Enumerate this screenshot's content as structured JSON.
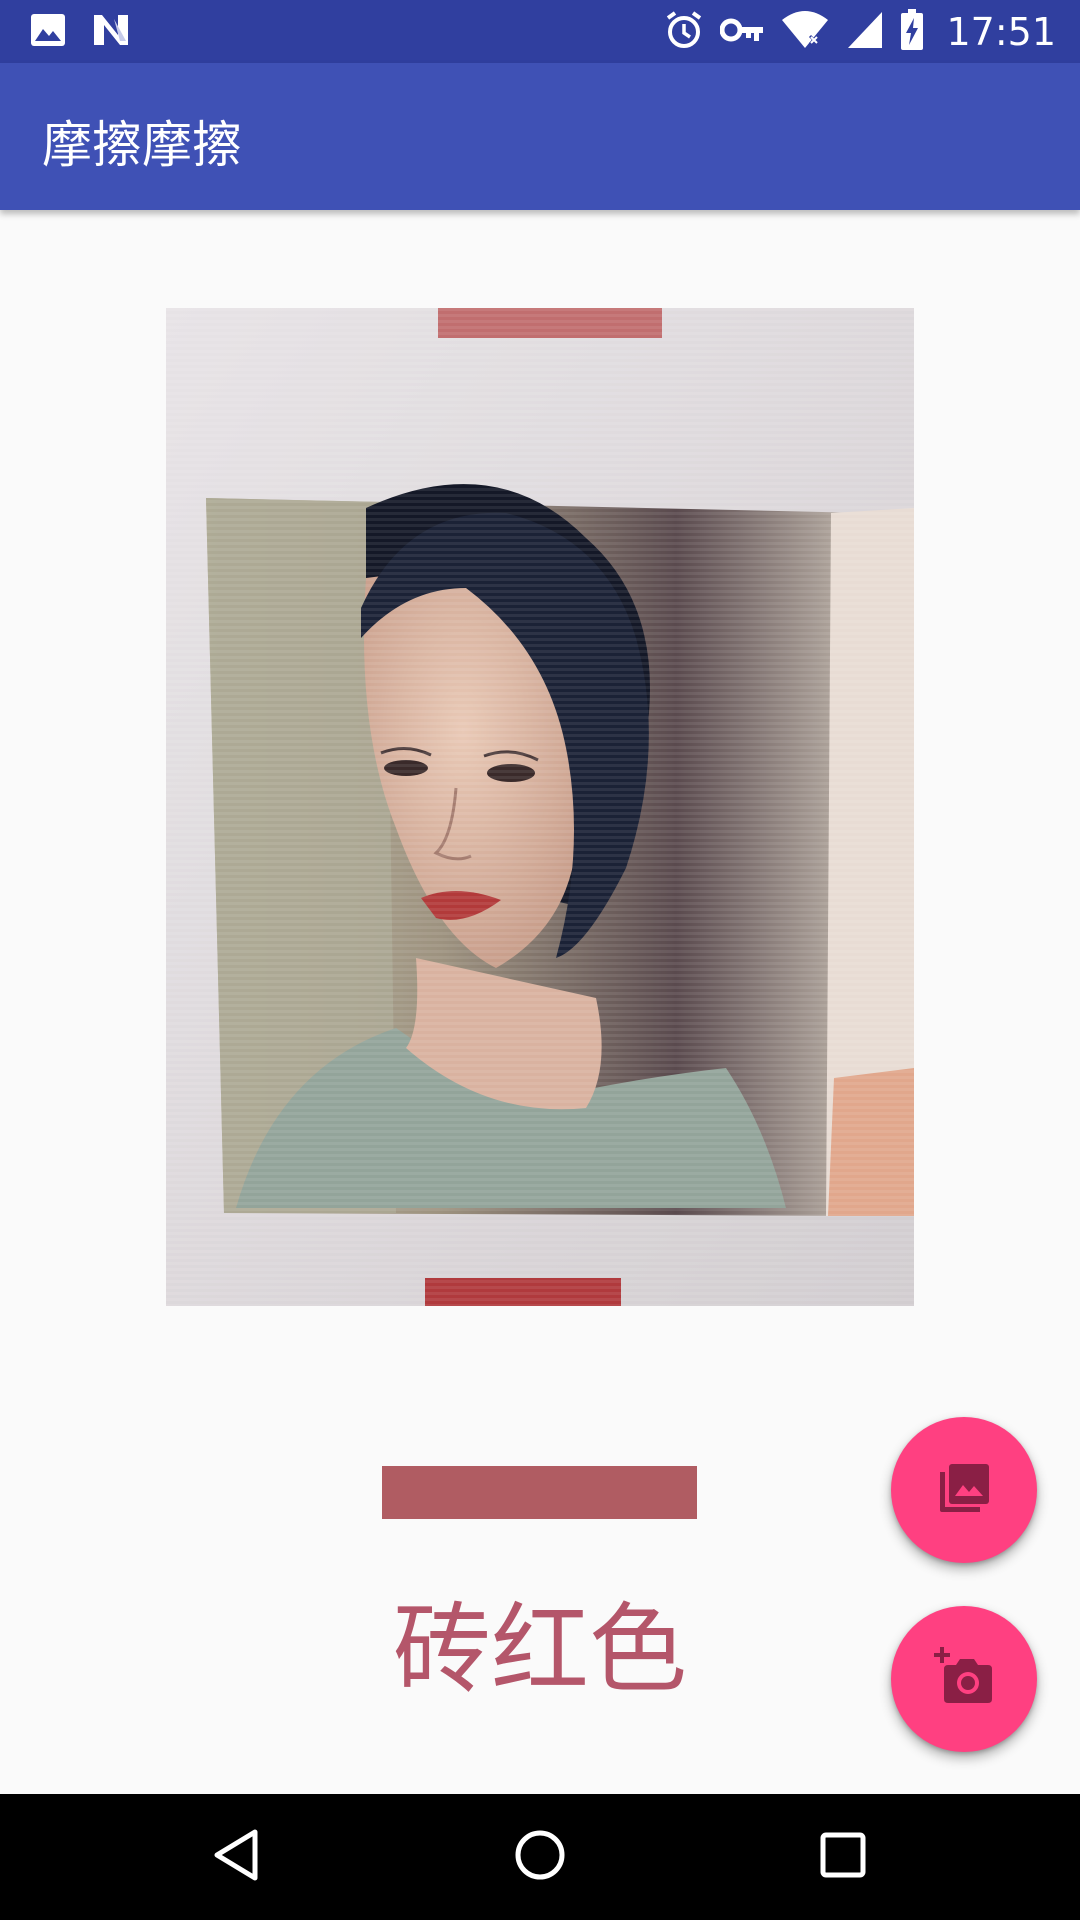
{
  "status_bar": {
    "time": "17:51",
    "left_icons": [
      "image-notification-icon",
      "n-notification-icon"
    ],
    "right_icons": [
      "alarm-icon",
      "vpn-key-icon",
      "wifi-icon",
      "signal-icon",
      "battery-charging-icon"
    ]
  },
  "app_bar": {
    "title": "摩擦摩擦"
  },
  "result": {
    "color_name": "砖红色",
    "color_hex": "#b05c62",
    "text_color": "#b4566a"
  },
  "fabs": {
    "accent": "#ff4081",
    "icon_color": "#8a1f45",
    "gallery_icon": "photo-library-icon",
    "camera_icon": "add-a-photo-icon"
  },
  "nav_bar": {
    "icons": [
      "back-icon",
      "home-icon",
      "recents-icon"
    ]
  }
}
